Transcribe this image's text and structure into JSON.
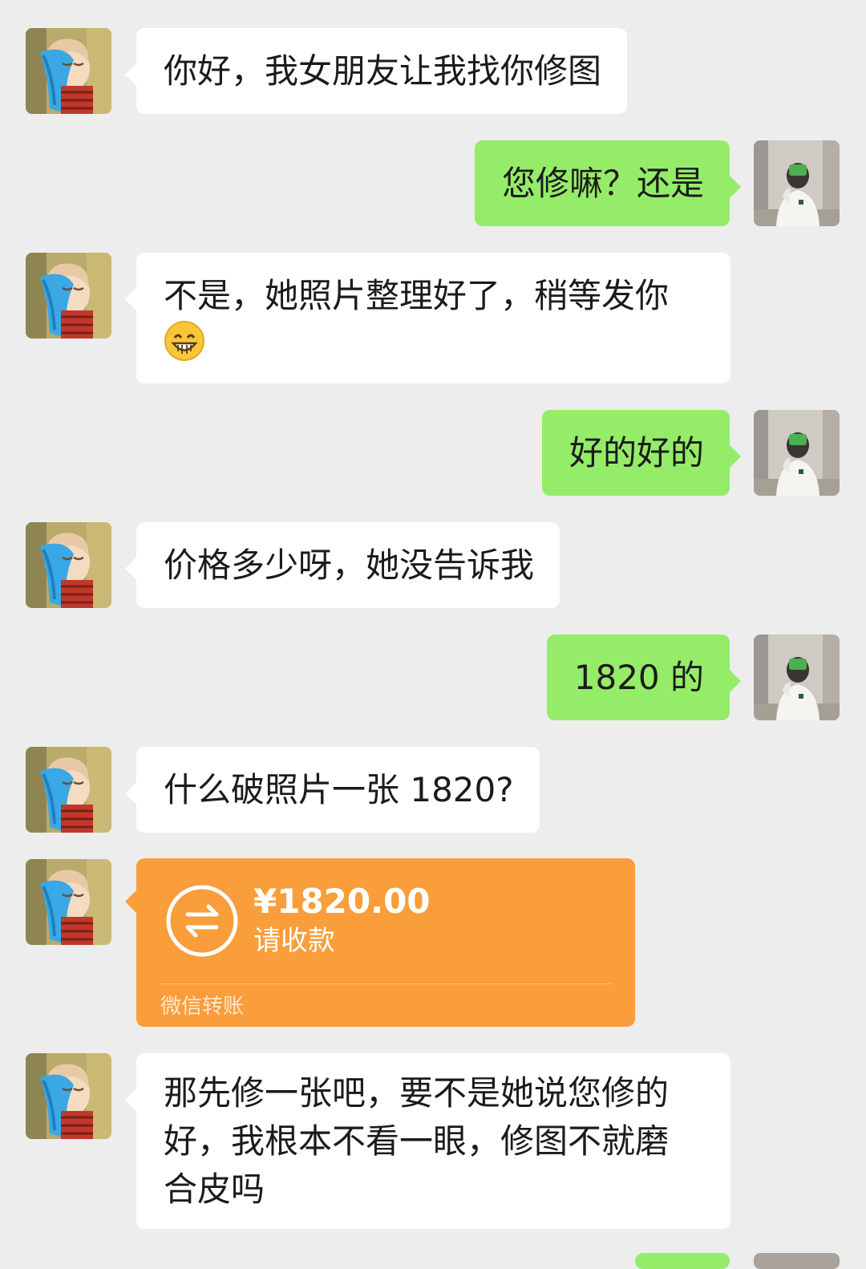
{
  "messages": [
    {
      "side": "in",
      "text": "你好，我女朋友让我找你修图"
    },
    {
      "side": "out",
      "text": "您修嘛？还是"
    },
    {
      "side": "in",
      "text": "不是，她照片整理好了，稍等发你",
      "emoji": "grinning-face-emoji"
    },
    {
      "side": "out",
      "text": "好的好的"
    },
    {
      "side": "in",
      "text": "价格多少呀，她没告诉我"
    },
    {
      "side": "out",
      "text": "1820 的"
    },
    {
      "side": "in",
      "text": "什么破照片一张 1820?"
    },
    {
      "side": "in",
      "type": "transfer",
      "amount": "¥1820.00",
      "status": "请收款",
      "footer": "微信转账"
    },
    {
      "side": "in",
      "text_lines": [
        "那先修一张吧，要不是她说您修的",
        "好，我根本不看一眼，修图不就磨",
        "合皮吗"
      ]
    }
  ],
  "colors": {
    "background": "#ededed",
    "incoming_bubble": "#ffffff",
    "outgoing_bubble": "#95ec69",
    "transfer_card": "#fa9d3b"
  },
  "icons": {
    "left_avatar": "cartoon-avatar",
    "right_avatar": "photo-avatar",
    "transfer": "transfer-arrows-icon"
  }
}
